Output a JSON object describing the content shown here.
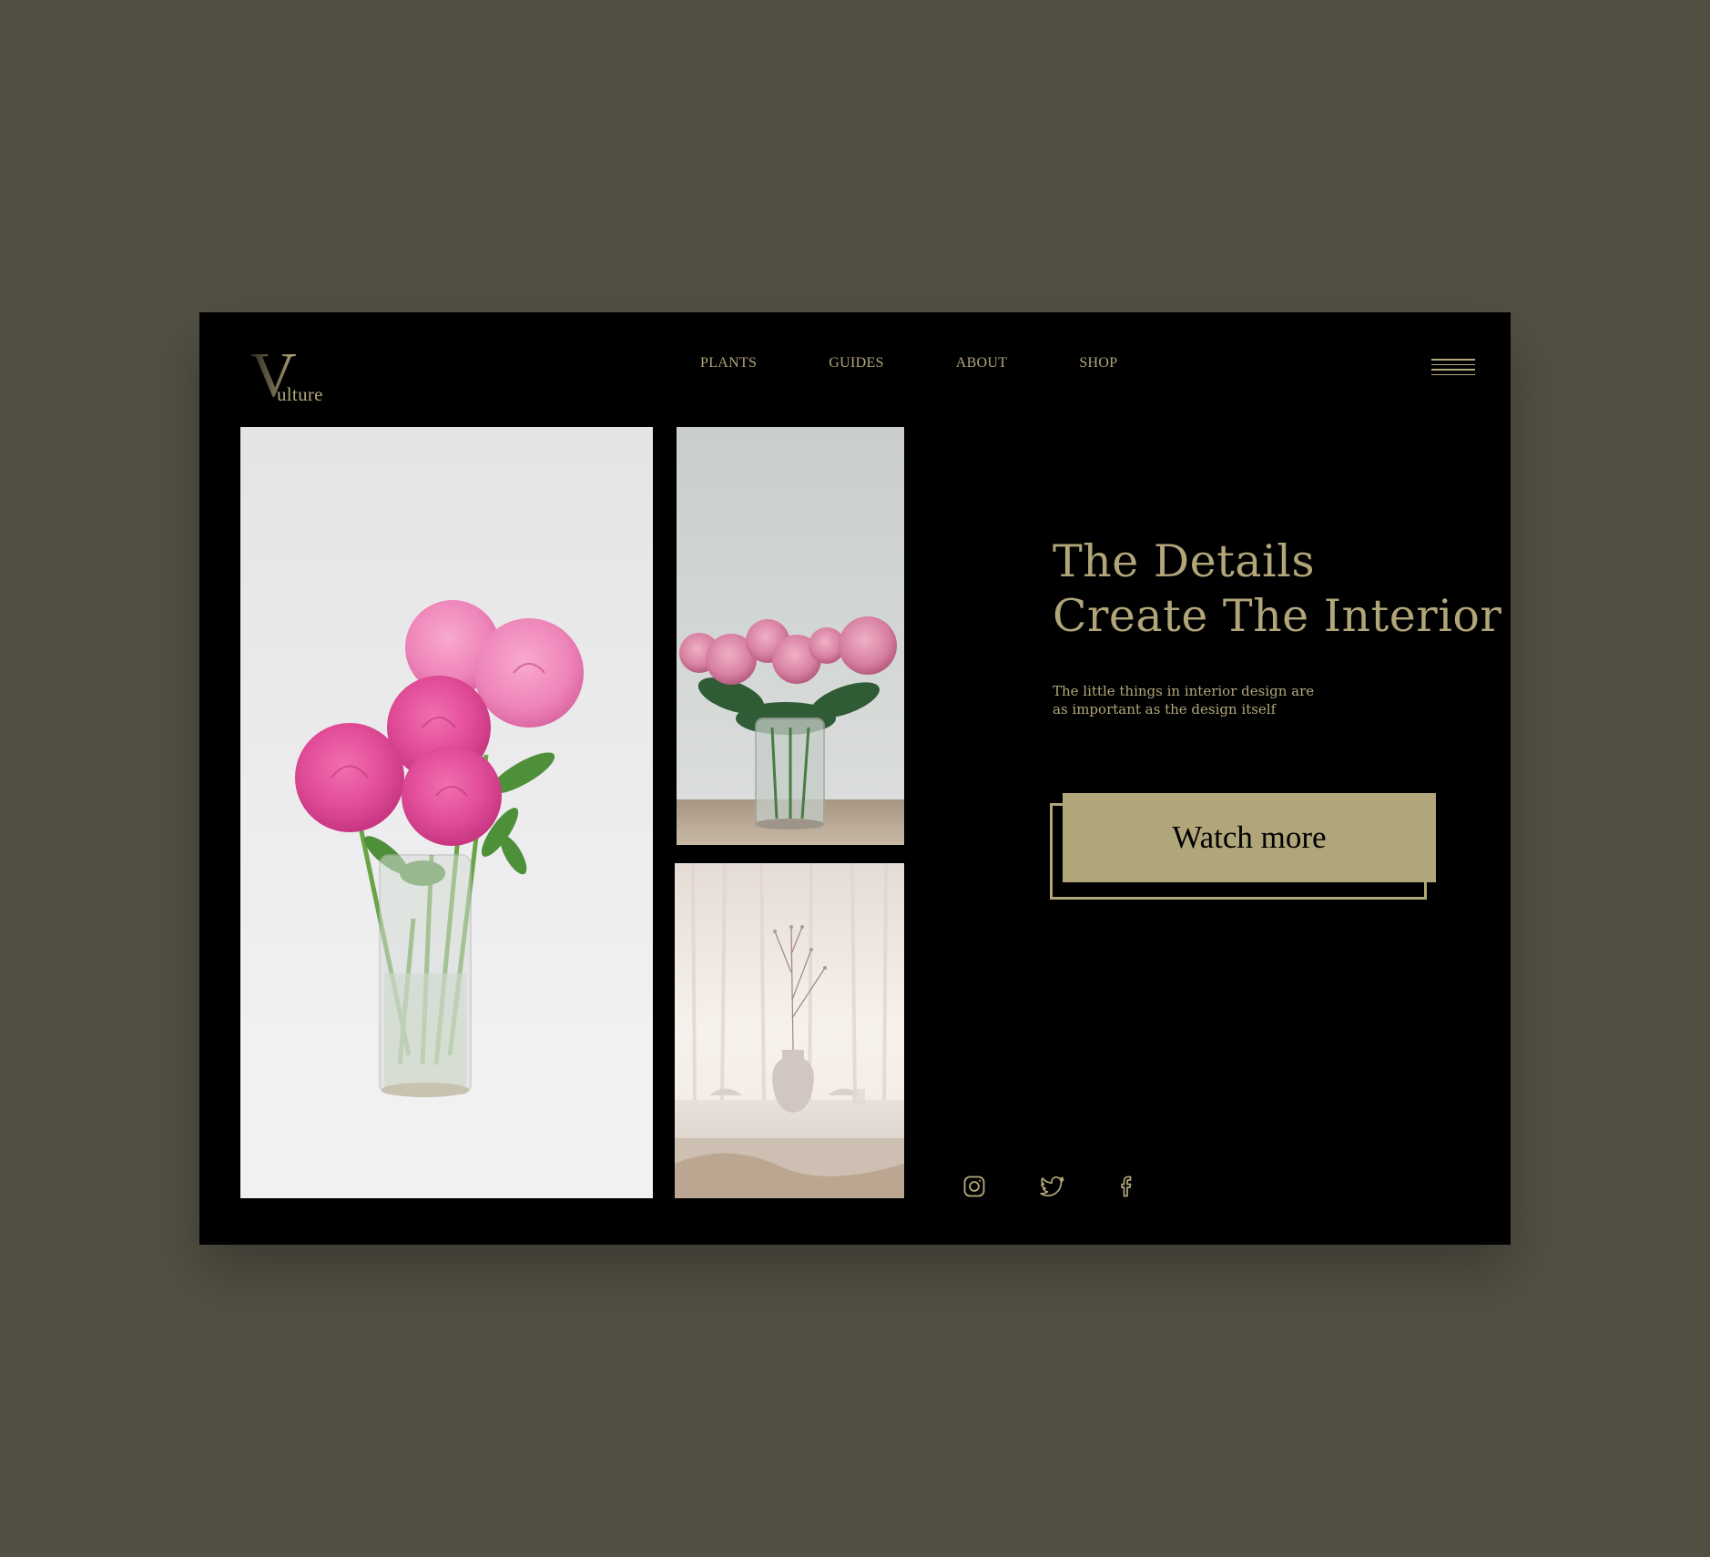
{
  "brand": {
    "initial": "V",
    "word": "ulture"
  },
  "nav": {
    "items": [
      {
        "label": "PLANTS"
      },
      {
        "label": "GUIDES"
      },
      {
        "label": "ABOUT"
      },
      {
        "label": "SHOP"
      }
    ],
    "menu_icon": "hamburger-icon"
  },
  "gallery": {
    "images": [
      {
        "subject": "pink peonies in tall glass vase"
      },
      {
        "subject": "pink peonies in vase on wooden table"
      },
      {
        "subject": "white ceramic vase with dry branch by curtains"
      }
    ]
  },
  "hero": {
    "title_line1": "The Details",
    "title_line2": "Create The Interior",
    "subtitle_line1": "The little things in interior design are",
    "subtitle_line2": "as important as the design itself",
    "cta_label": "Watch more"
  },
  "social": {
    "icons": [
      "instagram-icon",
      "twitter-icon",
      "facebook-icon"
    ]
  },
  "colors": {
    "background": "#524f43",
    "panel": "#000000",
    "accent": "#b1a679"
  }
}
